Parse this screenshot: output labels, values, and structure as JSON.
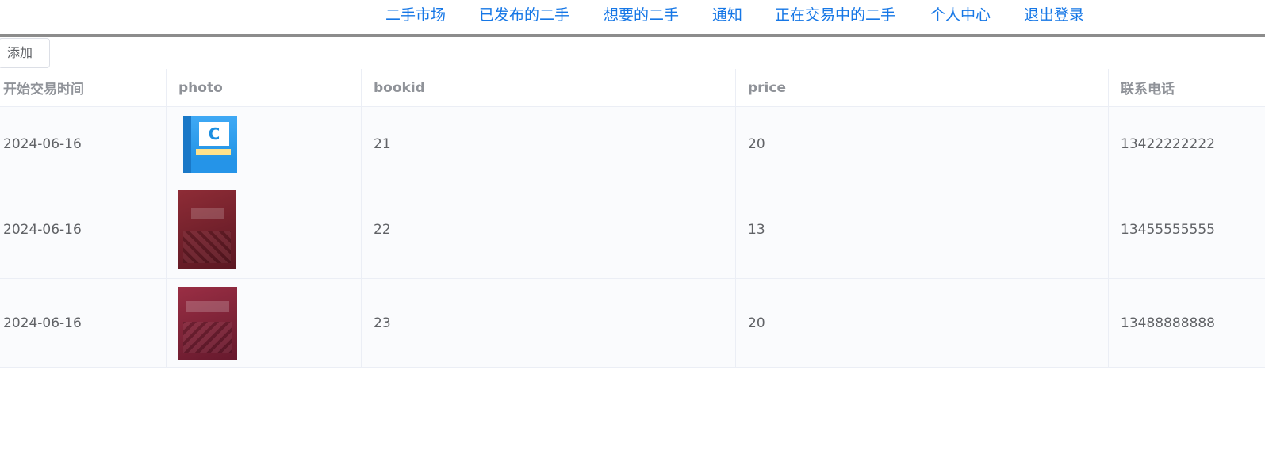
{
  "nav": {
    "links": [
      "二手市场",
      "已发布的二手",
      "想要的二手",
      "通知",
      "正在交易中的二手",
      "个人中心",
      "退出登录"
    ]
  },
  "toolbar": {
    "add_label": "添加"
  },
  "table": {
    "columns": [
      "开始交易时间",
      "photo",
      "bookid",
      "price",
      "联系电话"
    ],
    "rows": [
      {
        "start_time": "2024-06-16",
        "photo": "book-cover-c-language",
        "bookid": "21",
        "price": "20",
        "phone": "13422222222"
      },
      {
        "start_time": "2024-06-16",
        "photo": "book-cover-advanced-math",
        "bookid": "22",
        "price": "13",
        "phone": "13455555555"
      },
      {
        "start_time": "2024-06-16",
        "photo": "book-cover-computer-organization",
        "bookid": "23",
        "price": "20",
        "phone": "13488888888"
      }
    ]
  },
  "colors": {
    "link": "#1677e6",
    "divider": "#8c8c8c",
    "header_text": "#909399",
    "cell_text": "#606266"
  }
}
